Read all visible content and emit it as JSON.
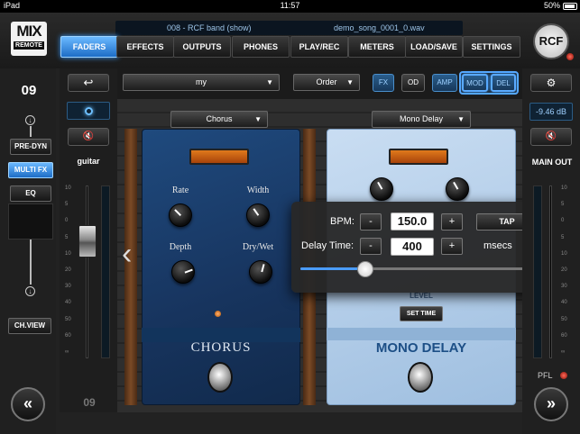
{
  "status": {
    "carrier": "iPad",
    "time": "11:57",
    "battery": "50%"
  },
  "header": {
    "logo_top": "MIX",
    "logo_bottom": "REMOTE",
    "scene": "008 - RCF band (show)",
    "song": "demo_song_0001_0.wav",
    "brand": "RCF",
    "tabs": [
      "FADERS",
      "EFFECTS",
      "OUTPUTS",
      "PHONES",
      "PLAY/REC",
      "METERS",
      "LOAD/SAVE",
      "SETTINGS"
    ],
    "active_tab": "FADERS"
  },
  "left": {
    "channel_number": "09",
    "buttons": [
      "PRE-DYN",
      "MULTI FX",
      "EQ"
    ],
    "active_button": "MULTI FX",
    "ch_view": "CH.VIEW",
    "nav_prev": "«"
  },
  "strip": {
    "back_icon": "↩",
    "mute_icon": "🔇",
    "name": "guitar",
    "scale": [
      "10",
      "5",
      "0",
      "5",
      "10",
      "20",
      "30",
      "40",
      "50",
      "60",
      "∞"
    ],
    "bottom_number": "09",
    "fader_level": 0.72
  },
  "fx": {
    "preset": "my",
    "order": "Order",
    "toggles": [
      {
        "label": "FX",
        "state": "blue"
      },
      {
        "label": "OD",
        "state": "off"
      },
      {
        "label": "AMP",
        "state": "blue"
      },
      {
        "label": "MOD",
        "state": "on"
      },
      {
        "label": "DEL",
        "state": "on"
      }
    ],
    "slot1": "Chorus",
    "slot2": "Mono Delay"
  },
  "chorus": {
    "knobs": [
      "Rate",
      "Width",
      "Depth",
      "Dry/Wet"
    ],
    "name": "CHORUS"
  },
  "delay": {
    "level_label": "LEVEL",
    "set_time": "SET TIME",
    "name": "MONO DELAY"
  },
  "popup": {
    "bpm_label": "BPM:",
    "bpm_value": "150.0",
    "delay_label": "Delay Time:",
    "delay_value": "400",
    "unit": "msecs",
    "minus": "-",
    "plus": "+",
    "tap": "TAP",
    "slider_value": 0.27
  },
  "right": {
    "gear_icon": "⚙",
    "db": "-9.46 dB",
    "main_out": "MAIN OUT",
    "pfl": "PFL",
    "nav_next": "»",
    "scale": [
      "10",
      "5",
      "0",
      "5",
      "10",
      "20",
      "30",
      "40",
      "50",
      "60",
      "∞"
    ]
  }
}
